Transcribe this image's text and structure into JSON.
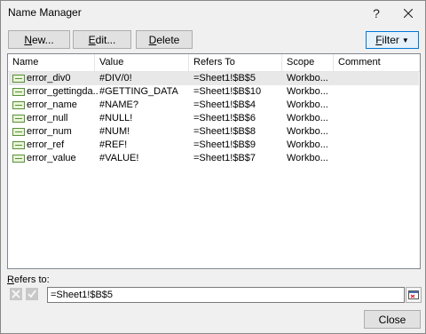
{
  "window": {
    "title": "Name Manager",
    "help_glyph": "?",
    "close_icon": "close-icon"
  },
  "toolbar": {
    "new_label_u": "N",
    "new_label_rest": "ew...",
    "edit_label_u": "E",
    "edit_label_rest": "dit...",
    "delete_label_u": "D",
    "delete_label_rest": "elete",
    "filter_label_u": "F",
    "filter_label_rest": "ilter",
    "filter_arrow": "▼"
  },
  "table": {
    "columns": [
      "Name",
      "Value",
      "Refers To",
      "Scope",
      "Comment"
    ],
    "rows": [
      {
        "name": "error_div0",
        "value": "#DIV/0!",
        "refers_to": "=Sheet1!$B$5",
        "scope": "Workbo...",
        "comment": "",
        "selected": true
      },
      {
        "name": "error_gettingda...",
        "value": "#GETTING_DATA",
        "refers_to": "=Sheet1!$B$10",
        "scope": "Workbo...",
        "comment": "",
        "selected": false
      },
      {
        "name": "error_name",
        "value": "#NAME?",
        "refers_to": "=Sheet1!$B$4",
        "scope": "Workbo...",
        "comment": "",
        "selected": false
      },
      {
        "name": "error_null",
        "value": "#NULL!",
        "refers_to": "=Sheet1!$B$6",
        "scope": "Workbo...",
        "comment": "",
        "selected": false
      },
      {
        "name": "error_num",
        "value": "#NUM!",
        "refers_to": "=Sheet1!$B$8",
        "scope": "Workbo...",
        "comment": "",
        "selected": false
      },
      {
        "name": "error_ref",
        "value": "#REF!",
        "refers_to": "=Sheet1!$B$9",
        "scope": "Workbo...",
        "comment": "",
        "selected": false
      },
      {
        "name": "error_value",
        "value": "#VALUE!",
        "refers_to": "=Sheet1!$B$7",
        "scope": "Workbo...",
        "comment": "",
        "selected": false
      }
    ]
  },
  "refers": {
    "label_u": "R",
    "label_rest": "efers to:",
    "value": "=Sheet1!$B$5"
  },
  "footer": {
    "close_label": "Close"
  },
  "colors": {
    "accent": "#0078d7",
    "selected_row": "#e8e8e8"
  }
}
